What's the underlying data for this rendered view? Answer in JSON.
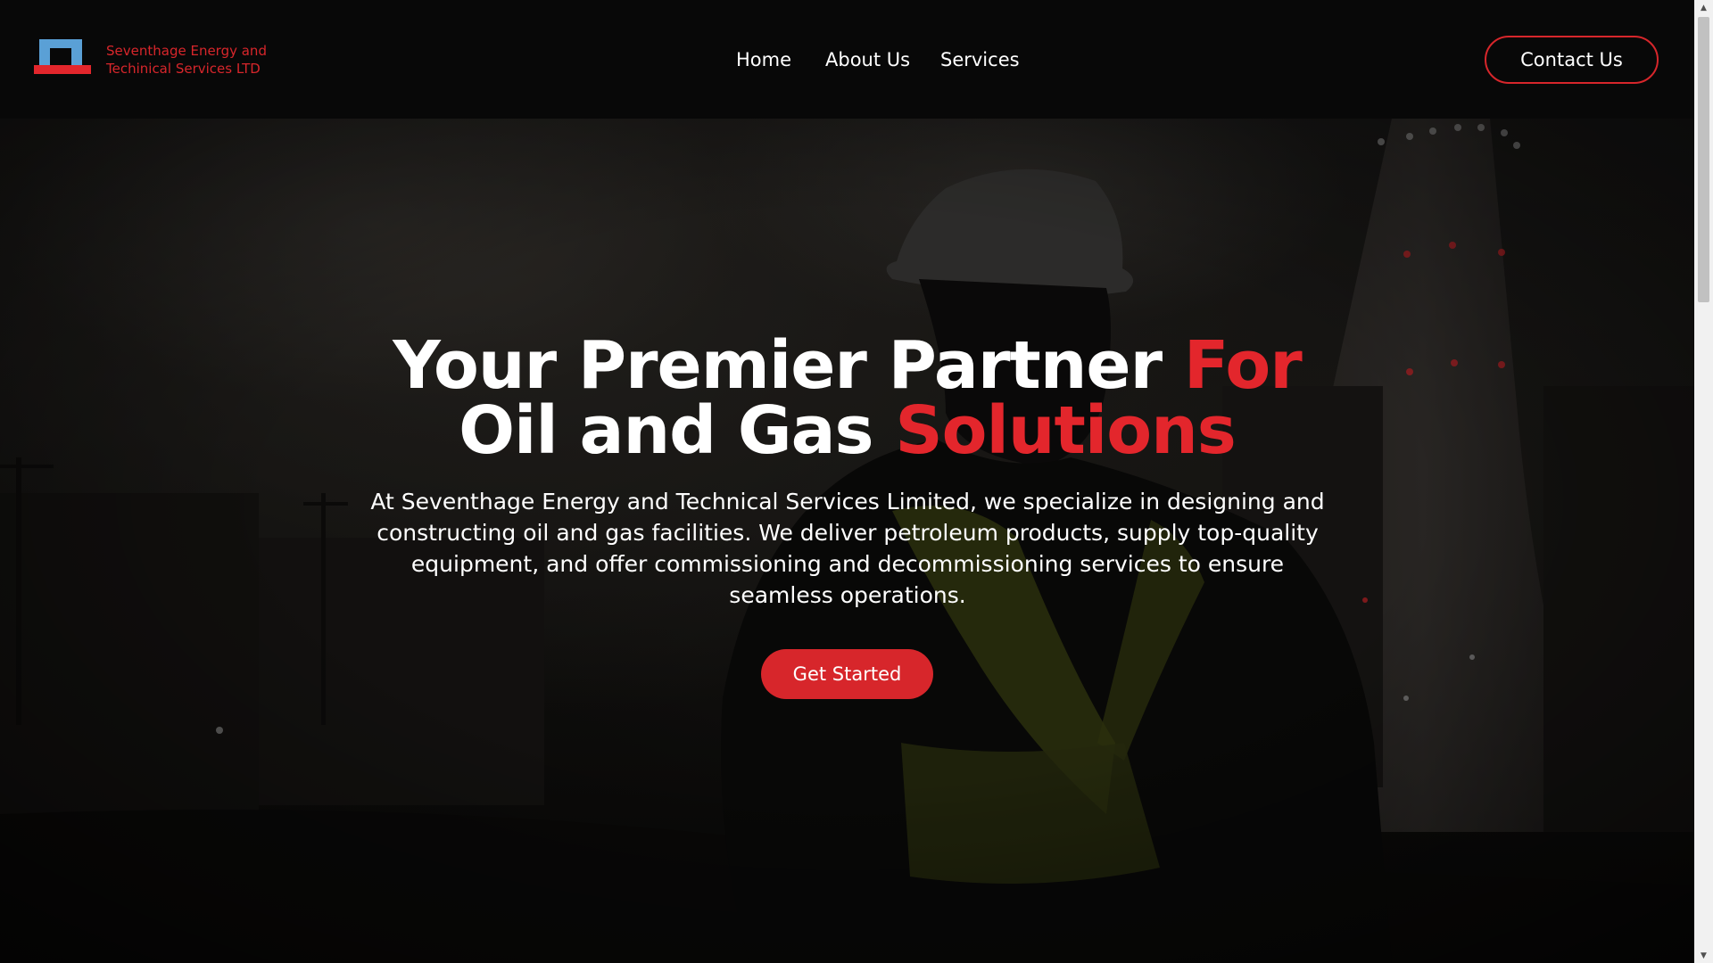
{
  "header": {
    "company_name": "Seventhage Energy and Techinical Services LTD",
    "nav": {
      "home": "Home",
      "about": "About Us",
      "services": "Services"
    },
    "contact_label": "Contact Us"
  },
  "hero": {
    "headline_line1_white": "Your Premier Partner ",
    "headline_line1_red": "For",
    "headline_line2_white": "Oil and Gas ",
    "headline_line2_red": "Solutions",
    "description": "At Seventhage Energy and Technical Services Limited, we specialize in designing and constructing oil and gas facilities. We deliver petroleum products, supply top-quality equipment, and offer commissioning and decommissioning services to ensure seamless operations.",
    "cta_label": "Get Started"
  },
  "colors": {
    "accent_red": "#d7262b",
    "header_bg": "#080808",
    "logo_blue": "#5aa0d6"
  },
  "icons": {
    "logo": "company-logo-icon",
    "scroll_up": "scroll-up-arrow-icon",
    "scroll_down": "scroll-down-arrow-icon"
  }
}
